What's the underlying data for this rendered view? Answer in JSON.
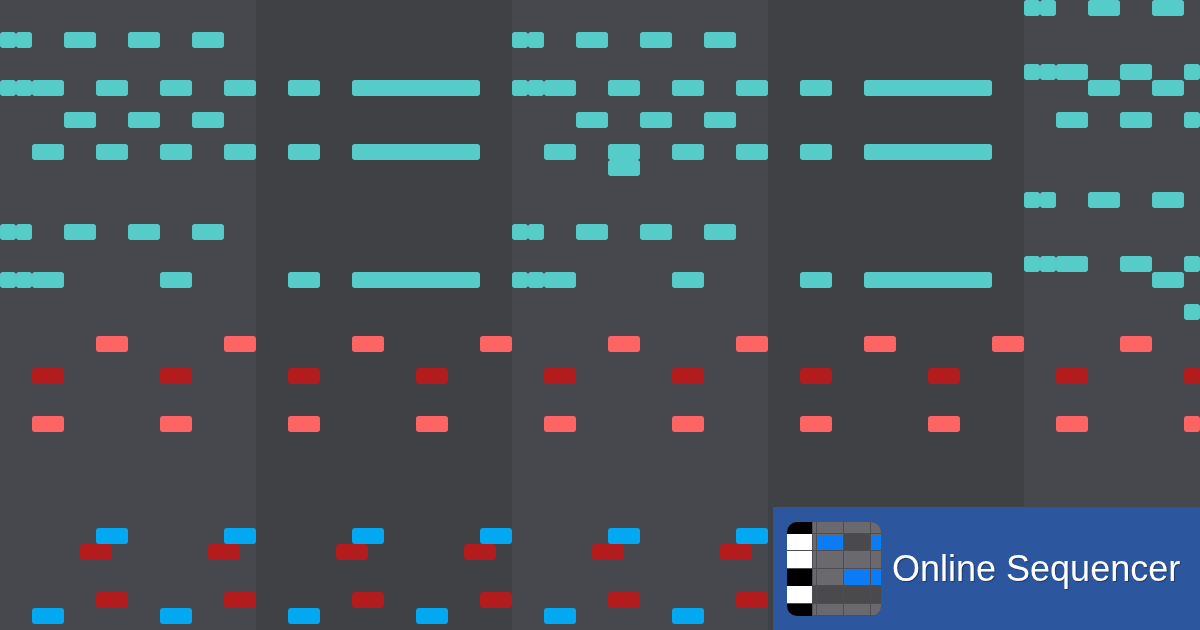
{
  "piano_roll": {
    "tracks": [
      {
        "color": "#55cbca"
      },
      {
        "color": "#ff6464"
      },
      {
        "color": "#b21c1c"
      },
      {
        "color": "#03a8f3"
      }
    ]
  },
  "banner": {
    "title": "Online Sequencer"
  }
}
